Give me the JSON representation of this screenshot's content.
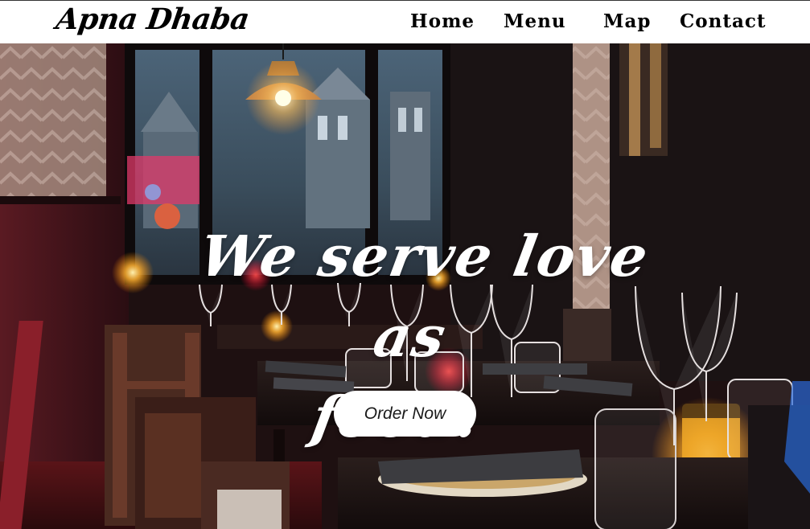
{
  "brand": {
    "name": "Apna Dhaba"
  },
  "nav": {
    "items": [
      {
        "label": "Home"
      },
      {
        "label": "Menu"
      },
      {
        "label": "Map"
      },
      {
        "label": "Contact"
      }
    ]
  },
  "hero": {
    "headline_line1": "We serve love as",
    "headline_line2": "food.",
    "cta_label": "Order Now",
    "background_image": "restaurant-interior-photo"
  },
  "colors": {
    "nav_background": "#ffffff",
    "nav_text": "#000000",
    "headline_text": "#ffffff",
    "button_background": "#ffffff",
    "button_text": "#1a1a1a"
  }
}
